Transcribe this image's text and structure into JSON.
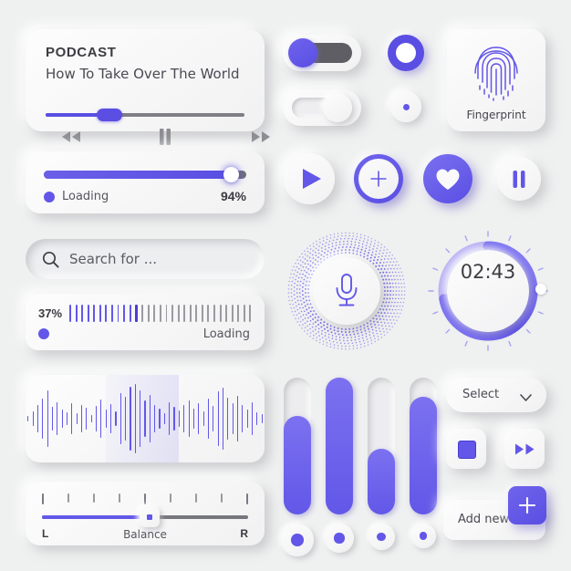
{
  "theme": {
    "background": "#eff0f0",
    "surface": "#f7f7f8",
    "accent": "#6257e8",
    "accent_dark": "#5a4ee3",
    "text": "#3c3c42",
    "muted": "#8d8d93"
  },
  "podcast": {
    "kicker": "PODCAST",
    "title": "How To Take Over The World",
    "progress_percent": 32,
    "controls": [
      {
        "name": "rewind",
        "icon": "rewind-icon"
      },
      {
        "name": "pause",
        "icon": "pause-icon"
      },
      {
        "name": "forward",
        "icon": "fast-forward-icon"
      }
    ]
  },
  "loading_bar": {
    "label": "Loading",
    "percent_text": "94%",
    "percent": 94
  },
  "search": {
    "placeholder": "Search for ...",
    "value": "",
    "icon": "search-icon"
  },
  "ticks_loader": {
    "percent_text": "37%",
    "percent": 37,
    "label": "Loading",
    "total_ticks": 31,
    "active_ticks": 12
  },
  "waveform": {
    "name": "audio-waveform",
    "highlight_start": 88,
    "highlight_width": 80,
    "bars": [
      6,
      16,
      30,
      44,
      62,
      26,
      36,
      20,
      14,
      34,
      12,
      30,
      24,
      8,
      28,
      42,
      20,
      32,
      16,
      56,
      48,
      70,
      76,
      62,
      40,
      52,
      30,
      22,
      12,
      36,
      26,
      18,
      30,
      40,
      22,
      34,
      16,
      44,
      28,
      60,
      68,
      46,
      34,
      50,
      30,
      20,
      36,
      14,
      10
    ]
  },
  "balance": {
    "left_label": "L",
    "right_label": "R",
    "center_label": "Balance",
    "value_percent": 52,
    "tick_count": 9
  },
  "toggles": [
    {
      "name": "toggle-on",
      "state": "on"
    },
    {
      "name": "toggle-off",
      "state": "off"
    }
  ],
  "radios": [
    {
      "name": "radio-selected",
      "state": "selected"
    },
    {
      "name": "radio-unselected",
      "state": "unselected"
    }
  ],
  "fingerprint": {
    "label": "Fingerprint",
    "icon": "fingerprint-icon"
  },
  "action_buttons": [
    {
      "name": "play-button",
      "icon": "play-icon",
      "style": "light"
    },
    {
      "name": "add-button",
      "icon": "plus-icon",
      "style": "ring"
    },
    {
      "name": "like-button",
      "icon": "heart-icon",
      "style": "filled"
    },
    {
      "name": "pause-button",
      "icon": "pause-icon",
      "style": "light"
    }
  ],
  "microphone": {
    "name": "microphone-button",
    "icon": "microphone-icon"
  },
  "timer": {
    "display": "02:43",
    "progress_percent": 72
  },
  "vertical_sliders": [
    {
      "name": "slider-1",
      "value_percent": 72,
      "dot_size": 22
    },
    {
      "name": "slider-2",
      "value_percent": 100,
      "dot_size": 18
    },
    {
      "name": "slider-3",
      "value_percent": 48,
      "dot_size": 15
    },
    {
      "name": "slider-4",
      "value_percent": 86,
      "dot_size": 13
    }
  ],
  "select": {
    "label": "Select",
    "chevron": "chevron-down-icon"
  },
  "small_buttons": [
    {
      "name": "stop-button",
      "icon": "stop-square-icon"
    },
    {
      "name": "forward-button",
      "icon": "fast-forward-icon"
    }
  ],
  "add_new": {
    "label": "Add new",
    "fab_icon": "plus-icon"
  }
}
